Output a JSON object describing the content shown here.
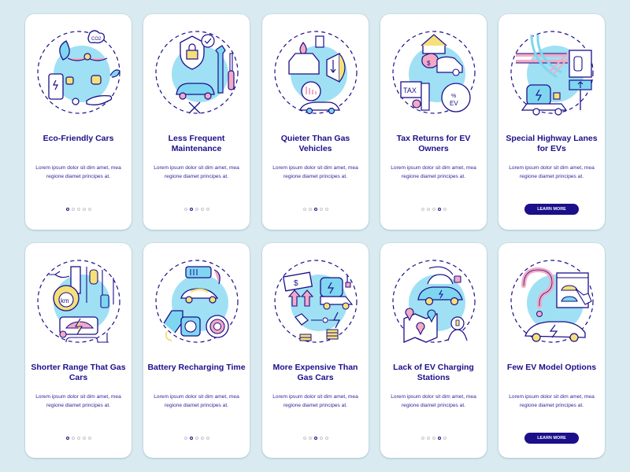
{
  "colors": {
    "background": "#d9eaf0",
    "card": "#ffffff",
    "navy": "#1b0f8a",
    "accent_cyan": "#7fd6f0",
    "accent_pink": "#f4a9c4",
    "accent_yellow": "#f5e07a"
  },
  "body_text": "Lorem ipsum dolor sit dim amet, mea regione diamet principes at.",
  "learn_more_label": "LEARN MORE",
  "rows": [
    {
      "cards": [
        {
          "title": "Eco-Friendly Cars",
          "illustration": "eco-friendly-cars-icon",
          "body": "Lorem ipsum dolor sit dim amet, mea regione diamet principes at.",
          "active_dot": 0,
          "total_dots": 5,
          "has_button": false
        },
        {
          "title": "Less Frequent Maintenance",
          "illustration": "maintenance-icon",
          "body": "Lorem ipsum dolor sit dim amet, mea regione diamet principes at.",
          "active_dot": 1,
          "total_dots": 5,
          "has_button": false
        },
        {
          "title": "Quieter Than Gas Vehicles",
          "illustration": "quiet-vehicle-icon",
          "body": "Lorem ipsum dolor sit dim amet, mea regione diamet principes at.",
          "active_dot": 2,
          "total_dots": 5,
          "has_button": false
        },
        {
          "title": "Tax Returns for EV Owners",
          "illustration": "tax-returns-icon",
          "body": "Lorem ipsum dolor sit dim amet, mea regione diamet principes at.",
          "active_dot": 3,
          "total_dots": 5,
          "has_button": false
        },
        {
          "title": "Special Highway Lanes for EVs",
          "illustration": "highway-lanes-icon",
          "body": "Lorem ipsum dolor sit dim amet, mea regione diamet principes at.",
          "active_dot": 4,
          "total_dots": 5,
          "has_button": true,
          "button_label": "LEARN MORE"
        }
      ]
    },
    {
      "cards": [
        {
          "title": "Shorter Range That Gas Cars",
          "illustration": "shorter-range-icon",
          "body": "Lorem ipsum dolor sit dim amet, mea regione diamet principes at.",
          "active_dot": 0,
          "total_dots": 5,
          "has_button": false
        },
        {
          "title": "Battery Recharging Time",
          "illustration": "battery-recharging-icon",
          "body": "Lorem ipsum dolor sit dim amet, mea regione diamet principes at.",
          "active_dot": 1,
          "total_dots": 5,
          "has_button": false
        },
        {
          "title": "More Expensive Than Gas Cars",
          "illustration": "expensive-icon",
          "body": "Lorem ipsum dolor sit dim amet, mea regione diamet principes at.",
          "active_dot": 2,
          "total_dots": 5,
          "has_button": false
        },
        {
          "title": "Lack of EV Charging Stations",
          "illustration": "charging-stations-icon",
          "body": "Lorem ipsum dolor sit dim amet, mea regione diamet principes at.",
          "active_dot": 3,
          "total_dots": 5,
          "has_button": false
        },
        {
          "title": "Few EV Model Options",
          "illustration": "model-options-icon",
          "body": "Lorem ipsum dolor sit dim amet, mea regione diamet principes at.",
          "active_dot": 4,
          "total_dots": 5,
          "has_button": true,
          "button_label": "LEARN MORE"
        }
      ]
    }
  ]
}
